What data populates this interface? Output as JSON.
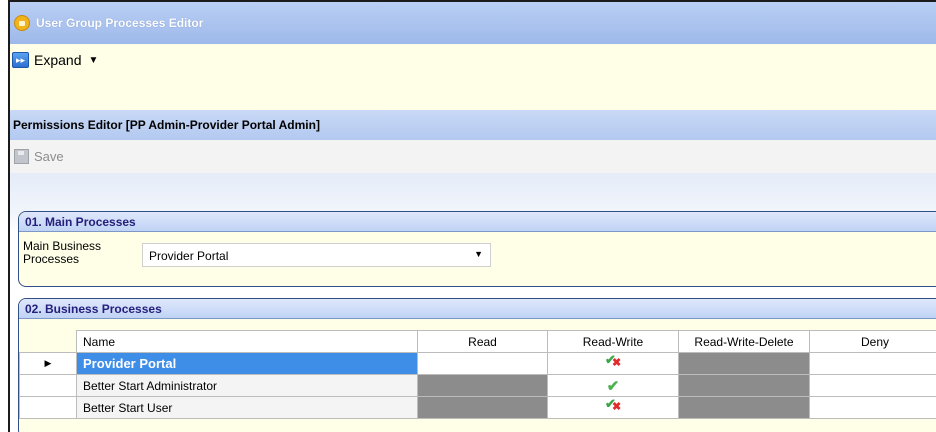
{
  "window": {
    "title": "User Group Processes Editor"
  },
  "toolbar": {
    "expand_label": "Expand"
  },
  "permissions_editor": {
    "title": "Permissions Editor [PP Admin-Provider Portal Admin]"
  },
  "save_toolbar": {
    "save_label": "Save"
  },
  "section_main": {
    "title": "01. Main Processes",
    "field_label": "Main Business Processes",
    "selected_value": "Provider Portal"
  },
  "section_business": {
    "title": "02. Business Processes",
    "columns": [
      "Name",
      "Read",
      "Read-Write",
      "Read-Write-Delete",
      "Deny"
    ],
    "rows": [
      {
        "name": "Provider Portal",
        "read": "empty",
        "read_write": "check-x",
        "read_write_delete": "gray",
        "deny": "empty",
        "selected": true
      },
      {
        "name": "Better Start Administrator",
        "read": "gray",
        "read_write": "check",
        "read_write_delete": "gray",
        "deny": "empty",
        "selected": false
      },
      {
        "name": "Better Start User",
        "read": "gray",
        "read_write": "check-x",
        "read_write_delete": "gray",
        "deny": "empty",
        "selected": false
      }
    ]
  },
  "colors": {
    "title_bar": "#a9c2ee",
    "selected_row": "#3e8ee8",
    "disabled_cell": "#8c8c8c",
    "section_title": "#25207c"
  }
}
